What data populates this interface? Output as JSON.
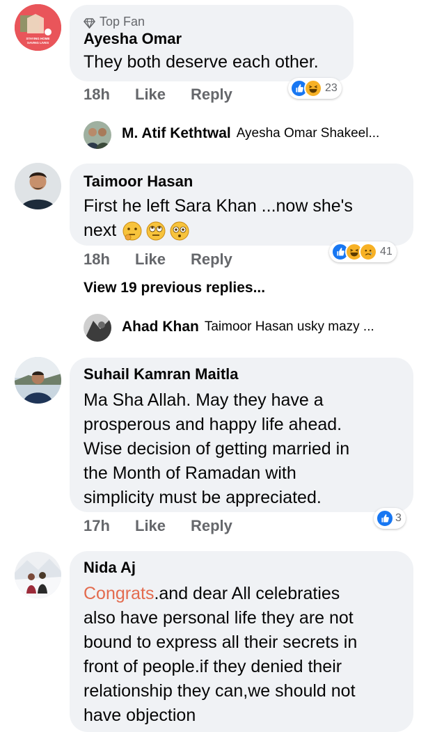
{
  "comments": [
    {
      "badge": "Top Fan",
      "name": "Ayesha Omar",
      "text": "They both deserve each other.",
      "time": "18h",
      "like": "Like",
      "reply": "Reply",
      "reaction_count": "23",
      "avatar_text": "STAYING HOME SAVING LIVES"
    },
    {
      "name": "Taimoor Hasan",
      "text_line1": "First he left Sara Khan ...now she's",
      "text_line2": "next",
      "time": "18h",
      "like": "Like",
      "reply": "Reply",
      "reaction_count": "41"
    },
    {
      "name": "Suhail Kamran Maitla",
      "text_lines": [
        "Ma Sha Allah. May they have a",
        "prosperous and happy life ahead.",
        "Wise decision of getting married in",
        "the Month of Ramadan with",
        "simplicity must be appreciated."
      ],
      "time": "17h",
      "like": "Like",
      "reply": "Reply",
      "reaction_count": "3"
    },
    {
      "name": "Nida Aj",
      "mention": "Congrats",
      "text_first_rest": ".and dear All celebraties",
      "text_lines": [
        "also have personal life they are not",
        "bound to express all their secrets in",
        "front of people.if they denied their",
        "relationship they can,we should not",
        "have objection"
      ]
    }
  ],
  "replies": [
    {
      "name": "M. Atif Kethtwal",
      "text": "Ayesha Omar Shakeel..."
    },
    {
      "name": "Ahad Khan",
      "text": "Taimoor Hasan usky mazy ..."
    }
  ],
  "view_previous": "View 19 previous replies...",
  "colors": {
    "like_blue": "#1877f2",
    "haha_yellow": "#f7b125",
    "mention": "#e36b4e",
    "bubble": "#f0f2f5"
  }
}
